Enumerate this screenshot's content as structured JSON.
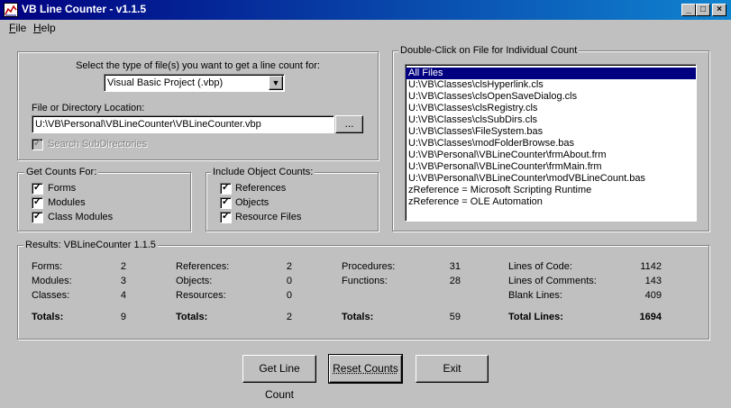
{
  "window": {
    "title": "VB Line Counter - v1.1.5",
    "minimize": "_",
    "maximize": "□",
    "close": "×"
  },
  "menu": {
    "file": "F",
    "file_rest": "ile",
    "help": "H",
    "help_rest": "elp"
  },
  "file_type": {
    "label": "Select the type of file(s) you want to get a line count for:",
    "selected": "Visual Basic Project (.vbp)"
  },
  "location": {
    "label": "File or Directory Location:",
    "value": "U:\\VB\\Personal\\VBLineCounter\\VBLineCounter.vbp",
    "browse": "..."
  },
  "search_subdirs": {
    "label": "Search SubDirectories",
    "checked": true,
    "disabled": true
  },
  "get_counts": {
    "title": "Get Counts For:",
    "items": [
      {
        "label": "Forms",
        "checked": true
      },
      {
        "label": "Modules",
        "checked": true
      },
      {
        "label": "Class Modules",
        "checked": true
      }
    ]
  },
  "object_counts": {
    "title": "Include Object Counts:",
    "items": [
      {
        "label": "References",
        "checked": true
      },
      {
        "label": "Objects",
        "checked": true
      },
      {
        "label": "Resource Files",
        "checked": true
      }
    ]
  },
  "file_list": {
    "title": "Double-Click on File for Individual Count",
    "items": [
      "All Files",
      "U:\\VB\\Classes\\clsHyperlink.cls",
      "U:\\VB\\Classes\\clsOpenSaveDialog.cls",
      "U:\\VB\\Classes\\clsRegistry.cls",
      "U:\\VB\\Classes\\clsSubDirs.cls",
      "U:\\VB\\Classes\\FileSystem.bas",
      "U:\\VB\\Classes\\modFolderBrowse.bas",
      "U:\\VB\\Personal\\VBLineCounter\\frmAbout.frm",
      "U:\\VB\\Personal\\VBLineCounter\\frmMain.frm",
      "U:\\VB\\Personal\\VBLineCounter\\modVBLineCount.bas",
      "zReference = Microsoft Scripting Runtime",
      "zReference = OLE Automation"
    ],
    "selected_index": 0
  },
  "results": {
    "title": "Results: VBLineCounter 1.1.5",
    "col1": {
      "rows": [
        [
          "Forms:",
          "2"
        ],
        [
          "Modules:",
          "3"
        ],
        [
          "Classes:",
          "4"
        ]
      ],
      "total_label": "Totals:",
      "total": "9"
    },
    "col2": {
      "rows": [
        [
          "References:",
          "2"
        ],
        [
          "Objects:",
          "0"
        ],
        [
          "Resources:",
          "0"
        ]
      ],
      "total_label": "Totals:",
      "total": "2"
    },
    "col3": {
      "rows": [
        [
          "Procedures:",
          "31"
        ],
        [
          "Functions:",
          "28"
        ]
      ],
      "total_label": "Totals:",
      "total": "59"
    },
    "col4": {
      "rows": [
        [
          "Lines of Code:",
          "1142"
        ],
        [
          "Lines of Comments:",
          "143"
        ],
        [
          "Blank Lines:",
          "409"
        ]
      ],
      "total_label": "Total Lines:",
      "total": "1694"
    }
  },
  "buttons": {
    "get_count": "Get Line Count",
    "reset": "Reset Counts",
    "exit": "Exit"
  }
}
